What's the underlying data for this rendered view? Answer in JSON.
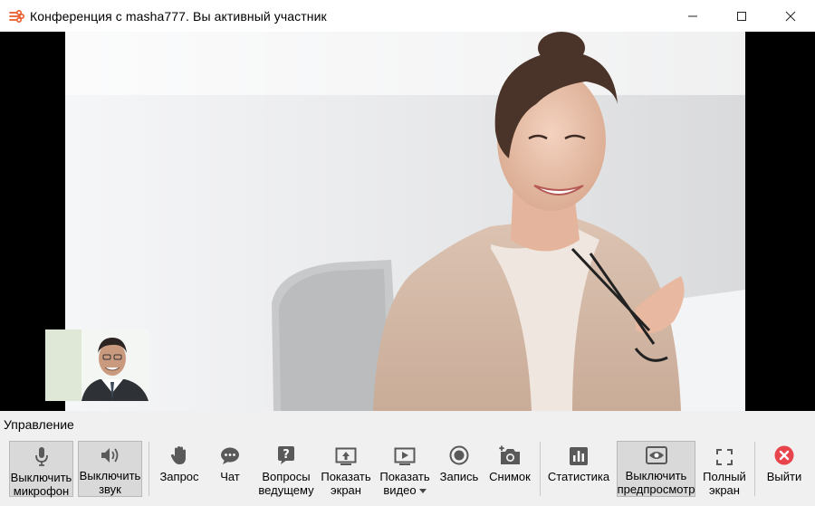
{
  "window": {
    "title": "Конференция с masha777. Вы активный участник",
    "controls": [
      "minimize-icon",
      "maximize-icon",
      "close-icon"
    ]
  },
  "colors": {
    "icon_gray": "#595959",
    "exit_red": "#e8444b",
    "panel_bg": "#f0f0f0",
    "active_btn_bg": "#d9d9d9"
  },
  "panel": {
    "label": "Управление"
  },
  "toolbar": {
    "mic": {
      "line1": "Выключить",
      "line2": "микрофон",
      "icon": "microphone-icon",
      "active": true
    },
    "sound": {
      "line1": "Выключить",
      "line2": "звук",
      "icon": "speaker-icon",
      "active": true
    },
    "request": {
      "label": "Запрос",
      "icon": "raise-hand-icon"
    },
    "chat": {
      "label": "Чат",
      "icon": "chat-bubble-icon"
    },
    "questions": {
      "line1": "Вопросы",
      "line2": "ведущему",
      "icon": "question-icon"
    },
    "share_screen": {
      "line1": "Показать",
      "line2": "экран",
      "icon": "share-screen-icon"
    },
    "share_video": {
      "line1": "Показать",
      "line2": "видео",
      "icon": "play-video-icon",
      "has_dropdown": true
    },
    "record": {
      "label": "Запись",
      "icon": "record-icon"
    },
    "snapshot": {
      "label": "Снимок",
      "icon": "camera-plus-icon"
    },
    "stats": {
      "label": "Статистика",
      "icon": "bar-chart-icon"
    },
    "preview": {
      "line1": "Выключить",
      "line2": "предпросмотр",
      "icon": "eye-icon",
      "active": true
    },
    "fullscreen": {
      "line1": "Полный",
      "line2": "экран",
      "icon": "fullscreen-icon"
    },
    "exit": {
      "label": "Выйти",
      "icon": "exit-x-icon"
    }
  }
}
